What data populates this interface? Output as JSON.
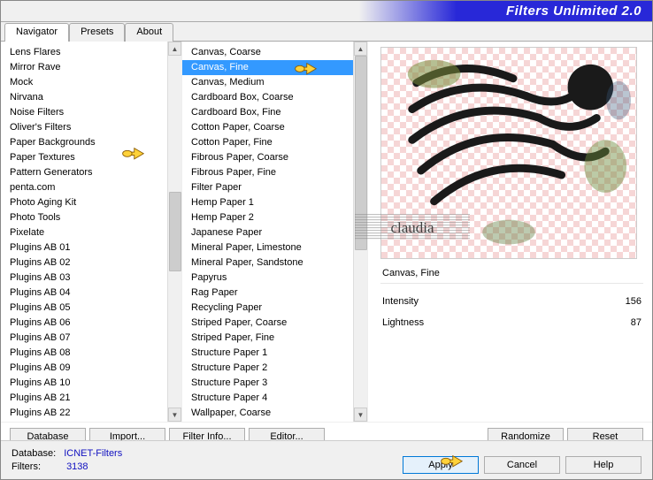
{
  "title": "Filters Unlimited 2.0",
  "tabs": [
    "Navigator",
    "Presets",
    "About"
  ],
  "active_tab": 0,
  "categories": [
    "Lens Flares",
    "Mirror Rave",
    "Mock",
    "Nirvana",
    "Noise Filters",
    "Oliver's Filters",
    "Paper Backgrounds",
    "Paper Textures",
    "Pattern Generators",
    "penta.com",
    "Photo Aging Kit",
    "Photo Tools",
    "Pixelate",
    "Plugins AB 01",
    "Plugins AB 02",
    "Plugins AB 03",
    "Plugins AB 04",
    "Plugins AB 05",
    "Plugins AB 06",
    "Plugins AB 07",
    "Plugins AB 08",
    "Plugins AB 09",
    "Plugins AB 10",
    "Plugins AB 21",
    "Plugins AB 22"
  ],
  "category_selected_index": 7,
  "filters": [
    "Canvas, Coarse",
    "Canvas, Fine",
    "Canvas, Medium",
    "Cardboard Box, Coarse",
    "Cardboard Box, Fine",
    "Cotton Paper, Coarse",
    "Cotton Paper, Fine",
    "Fibrous Paper, Coarse",
    "Fibrous Paper, Fine",
    "Filter Paper",
    "Hemp Paper 1",
    "Hemp Paper 2",
    "Japanese Paper",
    "Mineral Paper, Limestone",
    "Mineral Paper, Sandstone",
    "Papyrus",
    "Rag Paper",
    "Recycling Paper",
    "Striped Paper, Coarse",
    "Striped Paper, Fine",
    "Structure Paper 1",
    "Structure Paper 2",
    "Structure Paper 3",
    "Structure Paper 4",
    "Wallpaper, Coarse"
  ],
  "filter_selected_index": 1,
  "selected_filter_name": "Canvas, Fine",
  "params": {
    "intensity": {
      "label": "Intensity",
      "value": 156
    },
    "lightness": {
      "label": "Lightness",
      "value": 87
    }
  },
  "buttons": {
    "database": "Database",
    "import": "Import...",
    "filter_info": "Filter Info...",
    "editor": "Editor...",
    "randomize": "Randomize",
    "reset": "Reset",
    "apply": "Apply",
    "cancel": "Cancel",
    "help": "Help"
  },
  "status": {
    "db_label": "Database:",
    "db_value": "ICNET-Filters",
    "filters_label": "Filters:",
    "filters_value": "3138"
  },
  "watermark_text": "claudia"
}
